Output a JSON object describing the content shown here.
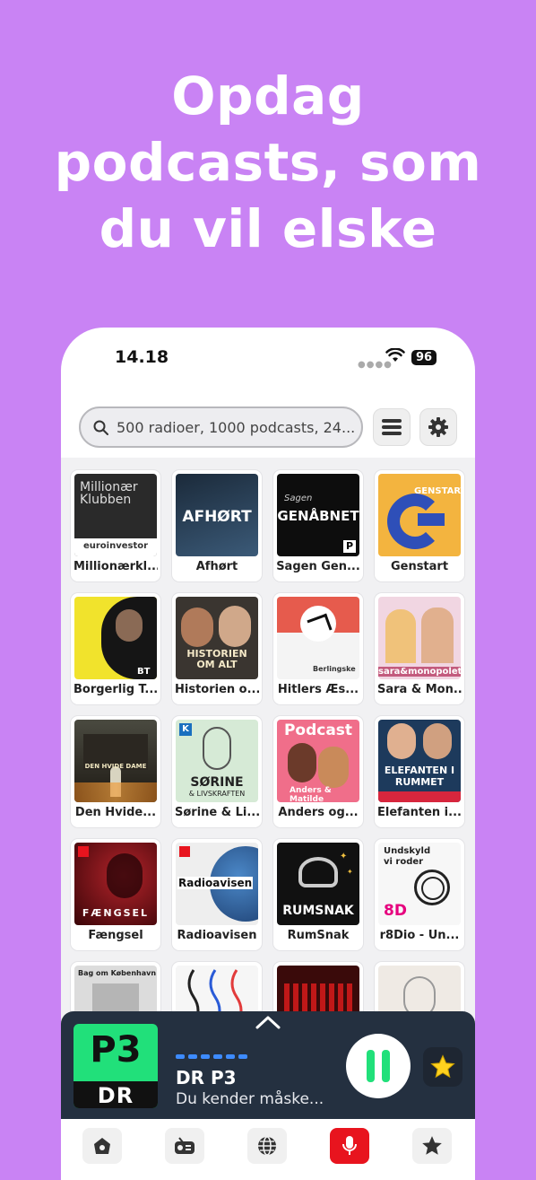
{
  "headline": {
    "line1": "Opdag",
    "line2": "podcasts, som",
    "line3": "du vil elske"
  },
  "status_bar": {
    "time": "14.18",
    "battery": "96"
  },
  "search": {
    "placeholder": "500 radioer, 1000 podcasts, 24..."
  },
  "podcasts": [
    {
      "label": "Millionærkl...",
      "art_text": "Millionær Klubben",
      "art_sub": "euroinvestor"
    },
    {
      "label": "Afhørt",
      "art_text": "AFHØRT"
    },
    {
      "label": "Sagen Gen...",
      "art_text": "GENÅBNET",
      "art_sub": "Sagen"
    },
    {
      "label": "Genstart",
      "art_text": "GENSTART"
    },
    {
      "label": "Borgerlig T...",
      "art_text": "BT"
    },
    {
      "label": "Historien o...",
      "art_text": "HISTORIEN OM ALT"
    },
    {
      "label": "Hitlers Æs...",
      "art_text": "Berlingske"
    },
    {
      "label": "Sara & Mon...",
      "art_text": "sara&monopolet"
    },
    {
      "label": "Den Hvide...",
      "art_text": "DEN HVIDE DAME"
    },
    {
      "label": "Sørine & Li...",
      "art_text": "SØRINE",
      "art_sub": "& LIVSKRAFTEN"
    },
    {
      "label": "Anders og...",
      "art_text": "Podcast",
      "art_sub": "Anders & Matilde"
    },
    {
      "label": "Elefanten i...",
      "art_text": "ELEFANTEN I RUMMET"
    },
    {
      "label": "Fængsel",
      "art_text": "FÆNGSEL"
    },
    {
      "label": "Radioavisen",
      "art_text": "Radioavisen"
    },
    {
      "label": "RumSnak",
      "art_text": "RUMSNAK"
    },
    {
      "label": "r8Dio - Un...",
      "art_text": "Undskyld vi roder",
      "art_sub": "8D"
    },
    {
      "label": "",
      "art_text": "Bag om København"
    },
    {
      "label": "",
      "art_text": ""
    },
    {
      "label": "",
      "art_text": ""
    },
    {
      "label": "",
      "art_text": ""
    }
  ],
  "player": {
    "logo_top": "P3",
    "logo_bottom": "DR",
    "station": "DR P3",
    "subtitle": "Du kender måske..."
  },
  "icons": {
    "search": "search-icon",
    "menu": "menu-icon",
    "settings": "gear-icon",
    "home": "home-icon",
    "radio": "radio-icon",
    "globe": "globe-icon",
    "podcast": "microphone-icon",
    "favorites": "star-icon"
  },
  "colors": {
    "background": "#c983f4",
    "accent_green": "#21e07a",
    "player_bg": "#243040",
    "podcast_tab": "#e8141e",
    "star": "#ffd21f"
  }
}
